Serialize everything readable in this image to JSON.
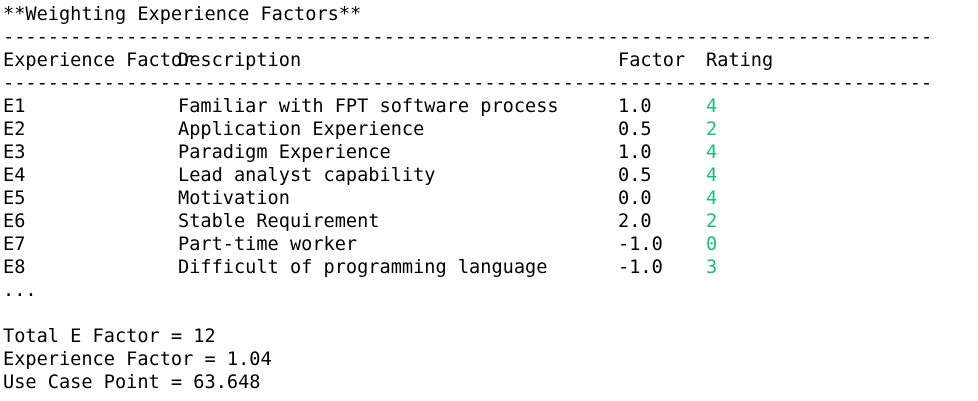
{
  "title": "**Weighting Experience Factors**",
  "divider": "-----------------------------------------------------------------------------------",
  "headers": {
    "factor": "Experience Factor",
    "description": "Description",
    "weight": "Factor",
    "rating": "Rating"
  },
  "rows": [
    {
      "id": "E1",
      "description": "Familiar with FPT software process",
      "factor": "1.0",
      "rating": "4"
    },
    {
      "id": "E2",
      "description": "Application Experience",
      "factor": "0.5",
      "rating": "2"
    },
    {
      "id": "E3",
      "description": "Paradigm Experience",
      "factor": "1.0",
      "rating": "4"
    },
    {
      "id": "E4",
      "description": "Lead analyst capability",
      "factor": "0.5",
      "rating": "4"
    },
    {
      "id": "E5",
      "description": "Motivation",
      "factor": "0.0",
      "rating": "4"
    },
    {
      "id": "E6",
      "description": "Stable Requirement",
      "factor": "2.0",
      "rating": "2"
    },
    {
      "id": "E7",
      "description": "Part-time worker",
      "factor": "-1.0",
      "rating": "0"
    },
    {
      "id": "E8",
      "description": "Difficult of programming language",
      "factor": "-1.0",
      "rating": "3"
    }
  ],
  "ellipsis": "...",
  "summary": {
    "total_e_factor": "Total E Factor = 12",
    "experience_factor": "Experience Factor = 1.04",
    "use_case_point": "Use Case Point = 63.648"
  },
  "colors": {
    "rating": "#1bbf7a",
    "text": "#000000",
    "background": "#ffffff"
  }
}
